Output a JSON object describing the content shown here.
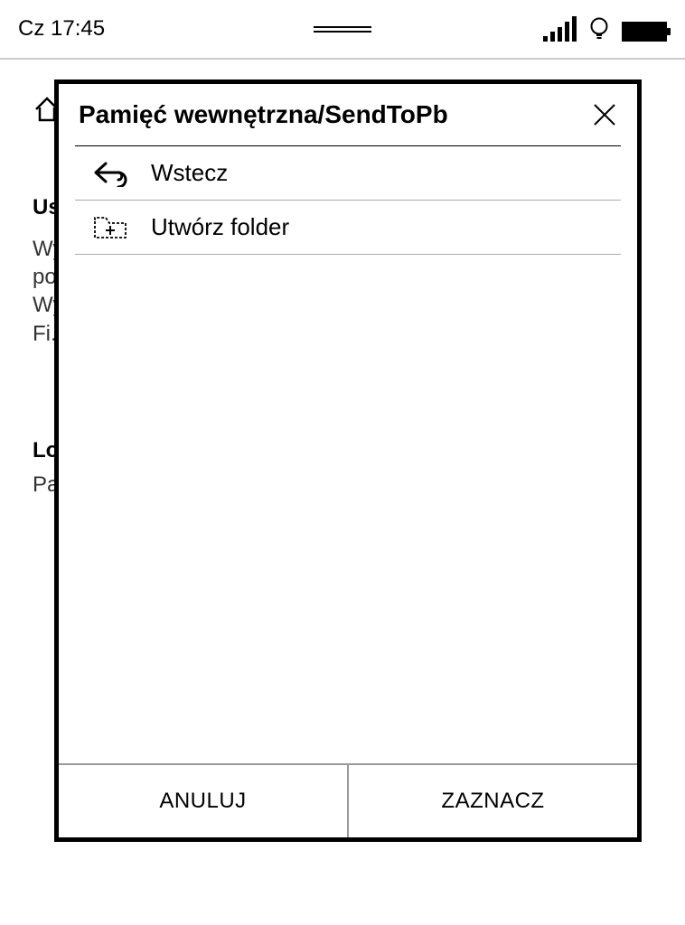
{
  "status": {
    "time": "Cz 17:45"
  },
  "background": {
    "heading1": "Us",
    "text_lines": [
      "Wy",
      "po",
      "Wy",
      "Fi."
    ],
    "heading2": "Lo",
    "text2": "Pa"
  },
  "dialog": {
    "title": "Pamięć wewnętrzna/SendToPb",
    "items": {
      "back": "Wstecz",
      "create_folder": "Utwórz folder"
    },
    "footer": {
      "cancel": "ANULUJ",
      "select": "ZAZNACZ"
    }
  }
}
